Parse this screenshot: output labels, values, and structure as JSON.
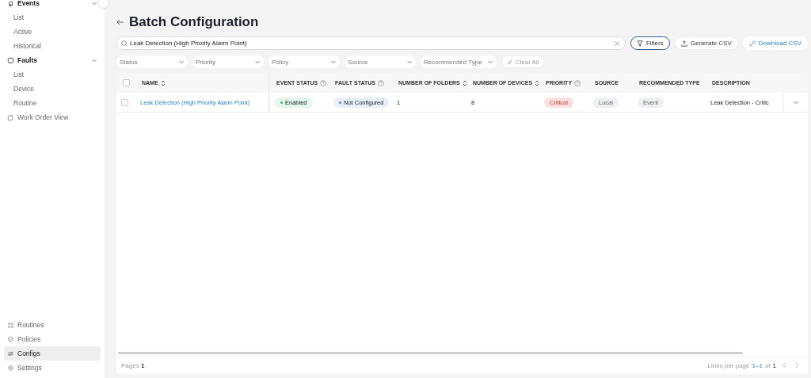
{
  "sidebar": {
    "top": [
      {
        "label": "Events",
        "kind": "section",
        "expanded": true
      },
      {
        "label": "List",
        "kind": "sub"
      },
      {
        "label": "Active",
        "kind": "sub"
      },
      {
        "label": "Historical",
        "kind": "sub"
      },
      {
        "label": "Faults",
        "kind": "section",
        "expanded": true
      },
      {
        "label": "List",
        "kind": "sub"
      },
      {
        "label": "Device",
        "kind": "sub"
      },
      {
        "label": "Routine",
        "kind": "sub"
      },
      {
        "label": "Work Order View",
        "kind": "link"
      }
    ],
    "bottom": [
      {
        "label": "Routines",
        "selected": false
      },
      {
        "label": "Policies",
        "selected": false
      },
      {
        "label": "Configs",
        "selected": true
      },
      {
        "label": "Settings",
        "selected": false
      }
    ]
  },
  "title": "Batch Configuration",
  "search": {
    "value": "Leak Detection (High Priority Alarm Point)"
  },
  "actions": [
    {
      "label": "Filters",
      "kind": "outline"
    },
    {
      "label": "Generate CSV",
      "kind": "plain"
    },
    {
      "label": "Download CSV",
      "kind": "link"
    }
  ],
  "filters": [
    {
      "placeholder": "Status"
    },
    {
      "placeholder": "Priority"
    },
    {
      "placeholder": "Policy"
    },
    {
      "placeholder": "Source"
    },
    {
      "placeholder": "Recommended Type"
    }
  ],
  "clear_all": "Clear All",
  "table": {
    "select_all_checked": false,
    "columns": [
      {
        "label": "NAME",
        "sortable": true,
        "help": false
      },
      {
        "label": "EVENT STATUS",
        "sortable": false,
        "help": true
      },
      {
        "label": "FAULT STATUS",
        "sortable": false,
        "help": true
      },
      {
        "label": "NUMBER OF FOLDERS",
        "sortable": true,
        "help": false
      },
      {
        "label": "NUMBER OF DEVICES",
        "sortable": true,
        "help": false
      },
      {
        "label": "PRIORITY",
        "sortable": false,
        "help": true
      },
      {
        "label": "SOURCE",
        "sortable": false,
        "help": false
      },
      {
        "label": "RECOMMENDED TYPE",
        "sortable": false,
        "help": false
      },
      {
        "label": "DESCRIPTION",
        "sortable": false,
        "help": false
      }
    ],
    "rows": [
      {
        "checked": false,
        "cells": [
          {
            "kind": "link",
            "text": "Leak Detection (High Priority Alarm Point)"
          },
          {
            "kind": "status",
            "text": "Enabled",
            "color": "#3cb878"
          },
          {
            "kind": "status",
            "text": "Not Configured",
            "color": "#4a8fe0"
          },
          {
            "kind": "text",
            "text": "1"
          },
          {
            "kind": "text",
            "text": "8"
          },
          {
            "kind": "danger",
            "text": "Critical"
          },
          {
            "kind": "pill",
            "text": "Local"
          },
          {
            "kind": "pill",
            "text": "Event"
          },
          {
            "kind": "text",
            "text": "Leak Detection - Critic"
          }
        ]
      }
    ]
  },
  "footer": {
    "pages": "Pages **1**",
    "lines_label": "Lines per page",
    "range": "1–1",
    "of": "of",
    "total": "1"
  }
}
